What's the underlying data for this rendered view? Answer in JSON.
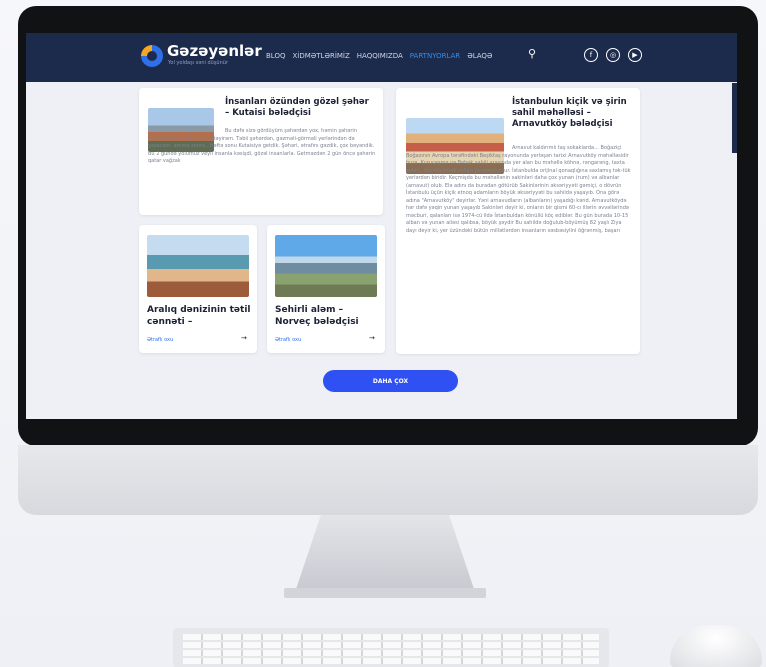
{
  "brand": {
    "name": "Gəzəyənlər",
    "tagline": "Yol yoldaşı səni düşünür"
  },
  "nav": {
    "items": [
      "BLOQ",
      "XİDMƏTLƏRİMİZ",
      "HAQQIMIZDA",
      "PARTNYORLAR",
      "ƏLAQƏ"
    ],
    "active_index": 3
  },
  "social": [
    "f",
    "◎",
    "▶"
  ],
  "icons": {
    "search": "⚲"
  },
  "cards": {
    "kutaisi": {
      "title": "İnsanları özündən gözəl şəhər – Kutaisi bələdçisi",
      "excerpt": "Bu dəfə sizə gördüyüm şəhərdən yox, həmin şəhərin insanlarından danışmaq istəyirəm. Təbii şəhərdən, gəzməli-görməli yerlərindən də yazacam, amma sonra...Həftə sonu Kutaisiyə getdik. Şəhəri, ətrafını gəzdik, çox bəyəndik. Bu 2 gündə yolumuz veyli insanla kəsişdi, gözəl insanlarla. Getməzdən 2 gün öncə şəhərin qatar vağzalı"
    },
    "istanbul": {
      "title": "İstanbulun kiçik və şirin sahil məhəlləsi – Arnavutköy bələdçisi",
      "excerpt": "Arnavut kaldırımlı taş sokaklarda... Boğaziçi Boğazının Avropa tərəfindəki Beşiktaş rayonunda yerləşən tarixi Arnavutköy məhəlləsidir bura. Kuruçeşmə və Bebek sahili arasında yer alan bu məhəllə köhnə, rəngarəng, taxta evləri, daş döşəməli yolları ilə məşhurdur. İstanbulda orijinal qonaqlığına saxlamış tək-tük yerlərdən biridir. Keçmişdə bu məhəllənin sakinləri daha çox yunan (rum) və albanlar (arnavut) olub. Elə adını da buradan götürüb Sakinlərinin əksəriyyəti gəmiçi, o dövrün İstanbulu üçün kiçik etnoq adamların böyük əksəriyyəti bu sahildə yaşayıb. Ona görə adına \"Arnavutköy\" deyirlər. Yəni arnavudların (albanların) yaşadığı kənd. Arnavutköydə hər dəfə yəqin yunan yaşayıb Sakinləri deyir ki, onların bir qismi 60-cı illərin əvvəllərində məcburi, qalanları isə 1974-cü ildə İstanbuldan könüllü köç ediblər. Bu gün burada 10-15 alban və yunan ailəsi qalıbsa, böyük şəydir Bu sahildə doğulub-böyümüş 82 yaşlı Ziya dayı deyir ki, yer üzündəki bütün millətlərdən insanların səsbəsiylini öğrənmiş, başarı"
    },
    "antalya": {
      "title": "Aralıq dənizinin tətil cənnəti –",
      "readmore": "Ətraflı oxu",
      "arrow": "→"
    },
    "norway": {
      "title": "Sehirli aləm – Norveç bələdçisi",
      "readmore": "Ətraflı oxu",
      "arrow": "→"
    }
  },
  "more_button": "DAHA ÇOX",
  "colors": {
    "nav_bg": "#1c2a4c",
    "accent": "#2f50f2",
    "active_nav": "#2f8ff0"
  }
}
